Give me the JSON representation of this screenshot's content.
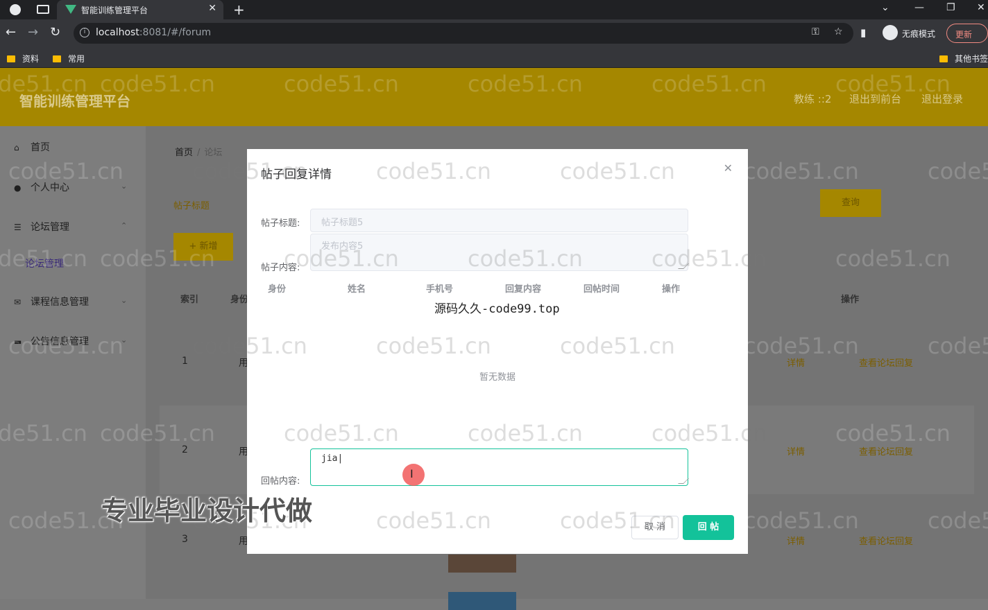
{
  "browser": {
    "tab_title": "智能训练管理平台",
    "url_host": "localhost",
    "url_rest": ":8081/#/forum",
    "incognito_label": "无痕模式",
    "update_label": "更新",
    "bookmarks": [
      "资料",
      "常用"
    ],
    "other_bookmarks": "其他书签"
  },
  "app": {
    "title": "智能训练管理平台",
    "header_links": [
      "教练 ::2",
      "退出到前台",
      "退出登录"
    ]
  },
  "sidebar": {
    "items": [
      {
        "label": "首页",
        "icon": "home-icon"
      },
      {
        "label": "个人中心",
        "icon": "user-icon"
      },
      {
        "label": "论坛管理",
        "icon": "menu-icon"
      },
      {
        "label": "课程信息管理",
        "icon": "mail-icon"
      },
      {
        "label": "公告信息管理",
        "icon": "truck-icon"
      }
    ],
    "sub_item": "论坛管理"
  },
  "main": {
    "breadcrumb": {
      "home": "首页",
      "current": "论坛"
    },
    "search_label": "帖子标题",
    "search_button": "查询",
    "add_button": "+ 新增",
    "columns": [
      "索引",
      "身份",
      "操作"
    ],
    "rows": [
      {
        "index": "1",
        "user": "用",
        "ops": [
          "详情",
          "查看论坛回复"
        ]
      },
      {
        "index": "2",
        "user": "用",
        "ops": [
          "详情",
          "查看论坛回复"
        ]
      },
      {
        "index": "3",
        "user": "用",
        "ops": [
          "详情",
          "查看论坛回复"
        ]
      }
    ]
  },
  "dialog": {
    "title": "帖子回复详情",
    "title_label": "帖子标题:",
    "title_value": "帖子标题5",
    "content_label": "帖子内容:",
    "content_value": "发布内容5",
    "table_headers": [
      "身份",
      "姓名",
      "手机号",
      "回复内容",
      "回帖时间",
      "操作"
    ],
    "empty_text": "暂无数据",
    "reply_label": "回帖内容:",
    "reply_value": "jia",
    "cancel_button": "取 消",
    "submit_button": "回 帖"
  },
  "overlays": {
    "watermark": "code51.cn",
    "source_text": "源码久久-code99.top",
    "promo_text": "专业毕业设计代做"
  }
}
